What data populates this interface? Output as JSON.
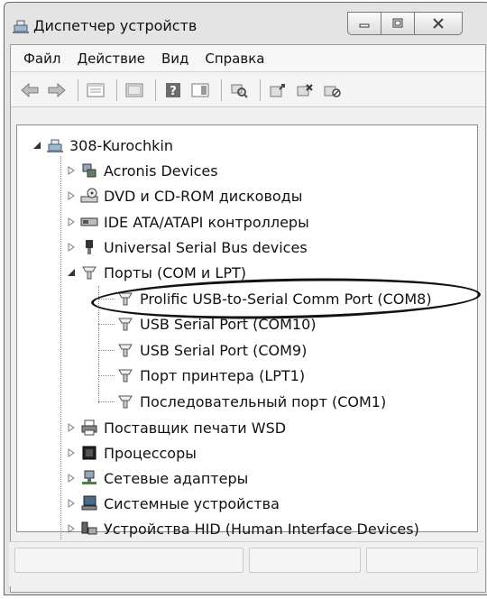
{
  "window": {
    "title": "Диспетчер устройств"
  },
  "menu": [
    "Файл",
    "Действие",
    "Вид",
    "Справка"
  ],
  "toolbar_icons": [
    "back-arrow-icon",
    "forward-arrow-icon",
    "properties-icon",
    "show-hide-console-tree-icon",
    "help-icon",
    "action-pane-icon",
    "scan-hardware-icon",
    "update-driver-icon",
    "uninstall-icon",
    "disable-device-icon"
  ],
  "tree": {
    "root": "308-Kurochkin",
    "items": [
      {
        "label": "Acronis Devices",
        "icon": "acronis-devices-icon",
        "expanded": false
      },
      {
        "label": "DVD и CD-ROM дисководы",
        "icon": "dvd-drive-icon",
        "expanded": false
      },
      {
        "label": "IDE ATA/ATAPI контроллеры",
        "icon": "ide-controller-icon",
        "expanded": false
      },
      {
        "label": "Universal Serial Bus devices",
        "icon": "usb-device-icon",
        "expanded": false
      },
      {
        "label": "Порты (COM и LPT)",
        "icon": "port-icon",
        "expanded": true,
        "children": [
          "Prolific USB-to-Serial Comm Port (COM8)",
          "USB Serial Port (COM10)",
          "USB Serial Port (COM9)",
          "Порт принтера (LPT1)",
          "Последовательный порт (COM1)"
        ]
      },
      {
        "label": "Поставщик печати WSD",
        "icon": "printer-icon",
        "expanded": false
      },
      {
        "label": "Процессоры",
        "icon": "processor-icon",
        "expanded": false
      },
      {
        "label": "Сетевые адаптеры",
        "icon": "network-adapter-icon",
        "expanded": false
      },
      {
        "label": "Системные устройства",
        "icon": "system-devices-icon",
        "expanded": false
      },
      {
        "label": "Устройства HID (Human Interface Devices)",
        "icon": "hid-device-icon",
        "expanded": false
      }
    ]
  },
  "highlight": {
    "target": "Prolific USB-to-Serial Comm Port (COM8)"
  },
  "colors": {
    "highlight_ellipse": "#111111",
    "tree_bg": "#ffffff",
    "chrome_bg": "#f0f0f0"
  }
}
